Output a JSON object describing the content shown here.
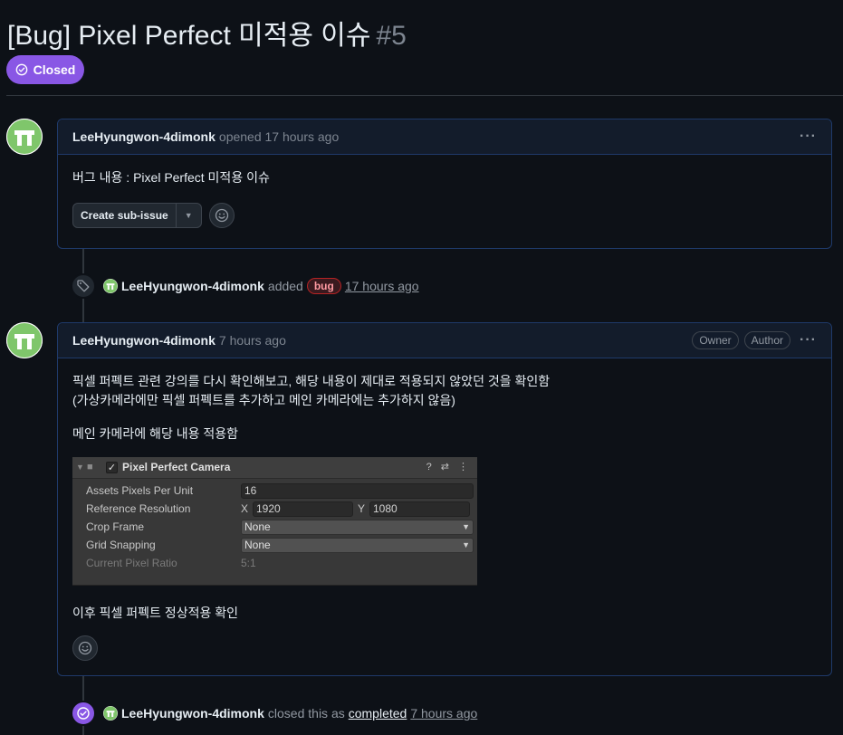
{
  "issue": {
    "title": "[Bug] Pixel Perfect 미적용 이슈",
    "number": "#5",
    "state": "Closed"
  },
  "comment1": {
    "author": "LeeHyungwon-4dimonk",
    "meta": "opened 17 hours ago",
    "body": "버그 내용 : Pixel Perfect 미적용 이슈",
    "sub_issue_button": "Create sub-issue",
    "more": "···"
  },
  "event_label": {
    "actor": "LeeHyungwon-4dimonk",
    "verb": "added",
    "label": "bug",
    "time": "17 hours ago",
    "label_color": "#b62324"
  },
  "comment2": {
    "author": "LeeHyungwon-4dimonk",
    "meta": "7 hours ago",
    "badges": [
      "Owner",
      "Author"
    ],
    "more": "···",
    "line1": "픽셀 퍼펙트 관련 강의를 다시 확인해보고, 해당 내용이 제대로 적용되지 않았던 것을 확인함",
    "line2": "(가상카메라에만 픽셀 퍼펙트를 추가하고 메인 카메라에는 추가하지 않음)",
    "line3": "메인 카메라에 해당 내용 적용함",
    "line4": "이후 픽셀 퍼펙트 정상적용 확인",
    "inspector": {
      "component": "Pixel Perfect Camera",
      "rows": [
        {
          "label": "Assets Pixels Per Unit",
          "value": "16"
        },
        {
          "label": "Reference Resolution",
          "x_label": "X",
          "x": "1920",
          "y_label": "Y",
          "y": "1080"
        },
        {
          "label": "Crop Frame",
          "value": "None"
        },
        {
          "label": "Grid Snapping",
          "value": "None"
        },
        {
          "label": "Current Pixel Ratio",
          "value": "5:1"
        }
      ]
    }
  },
  "event_closed": {
    "actor": "LeeHyungwon-4dimonk",
    "verb": "closed this as",
    "reason": "completed",
    "time": "7 hours ago"
  },
  "colors": {
    "closed_purple": "#8957e5",
    "background": "#0d1117",
    "border_accent": "#1f3a6a"
  }
}
